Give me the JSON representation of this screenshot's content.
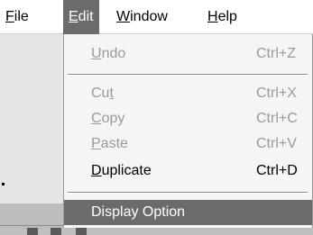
{
  "menubar": {
    "items": [
      {
        "label": "File",
        "mnemonic": "F",
        "rest": "ile"
      },
      {
        "label": "Edit",
        "mnemonic": "E",
        "rest": "dit"
      },
      {
        "label": "Window",
        "mnemonic": "W",
        "rest": "indow"
      },
      {
        "label": "Help",
        "mnemonic": "H",
        "rest": "elp"
      }
    ],
    "active": "Edit"
  },
  "edit_menu": {
    "items": [
      {
        "label": "Undo",
        "pre": "",
        "mn": "U",
        "post": "ndo",
        "shortcut": "Ctrl+Z",
        "enabled": false
      },
      {
        "label": "Cut",
        "pre": "Cu",
        "mn": "t",
        "post": "",
        "shortcut": "Ctrl+X",
        "enabled": false
      },
      {
        "label": "Copy",
        "pre": "",
        "mn": "C",
        "post": "opy",
        "shortcut": "Ctrl+C",
        "enabled": false
      },
      {
        "label": "Paste",
        "pre": "",
        "mn": "P",
        "post": "aste",
        "shortcut": "Ctrl+V",
        "enabled": false
      },
      {
        "label": "Duplicate",
        "pre": "",
        "mn": "D",
        "post": "uplicate",
        "shortcut": "Ctrl+D",
        "enabled": true
      },
      {
        "label": "Display Option",
        "shortcut": "",
        "enabled": true,
        "highlighted": true
      }
    ]
  },
  "colors": {
    "active_bg": "#6b6b6b",
    "disabled_text": "#9a9a9a",
    "menu_bg": "#f5f5f5"
  }
}
